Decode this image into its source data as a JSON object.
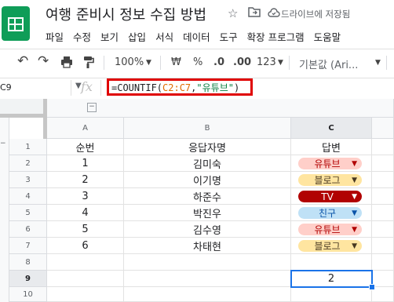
{
  "app": {
    "title": "여행 준비시 정보 수집 방법",
    "save_status": "드라이브에 저장됨"
  },
  "menu": [
    "파일",
    "수정",
    "보기",
    "삽입",
    "서식",
    "데이터",
    "도구",
    "확장 프로그램",
    "도움말"
  ],
  "toolbar": {
    "undo": "↶",
    "redo": "↷",
    "zoom": "100%",
    "currency": "₩",
    "percent": "%",
    "dec_decrease": ".0",
    "dec_increase": ".00",
    "more_formats": "123",
    "font": "기본값 (Ari..."
  },
  "formula_bar": {
    "cell_ref": "C9",
    "fx": "fx",
    "formula_prefix": "=COUNTIF(",
    "formula_range": "C2:C7",
    "formula_comma": ",",
    "formula_criteria": "\"유튜브\"",
    "formula_suffix": ")"
  },
  "columns": [
    "A",
    "B",
    "C"
  ],
  "rows": [
    "1",
    "2",
    "3",
    "4",
    "5",
    "6",
    "7",
    "8",
    "9",
    "10"
  ],
  "sheet": {
    "headers": {
      "a": "순번",
      "b": "응답자명",
      "c": "답변"
    },
    "data": [
      {
        "no": "1",
        "name": "김미숙",
        "answer": "유튜브",
        "chip_bg": "#ffcfc9",
        "chip_fg": "#b10202"
      },
      {
        "no": "2",
        "name": "이기명",
        "answer": "블로그",
        "chip_bg": "#ffe5a0",
        "chip_fg": "#473821"
      },
      {
        "no": "3",
        "name": "하준수",
        "answer": "TV",
        "chip_bg": "#b10202",
        "chip_fg": "#ffffff"
      },
      {
        "no": "4",
        "name": "박진우",
        "answer": "친구",
        "chip_bg": "#bfe1f6",
        "chip_fg": "#0a53a8"
      },
      {
        "no": "5",
        "name": "김수영",
        "answer": "유튜브",
        "chip_bg": "#ffcfc9",
        "chip_fg": "#b10202"
      },
      {
        "no": "6",
        "name": "차태현",
        "answer": "블로그",
        "chip_bg": "#ffe5a0",
        "chip_fg": "#473821"
      }
    ],
    "result": "2"
  },
  "colors": {
    "sheets_green": "#0f9d58",
    "highlight_red": "#e00000",
    "selection_blue": "#1a73e8"
  },
  "icons": [
    "sheets-logo-icon",
    "star-icon",
    "move-folder-icon",
    "cloud-saved-icon",
    "undo-icon",
    "redo-icon",
    "print-icon",
    "paint-format-icon",
    "dropdown-caret-icon"
  ]
}
